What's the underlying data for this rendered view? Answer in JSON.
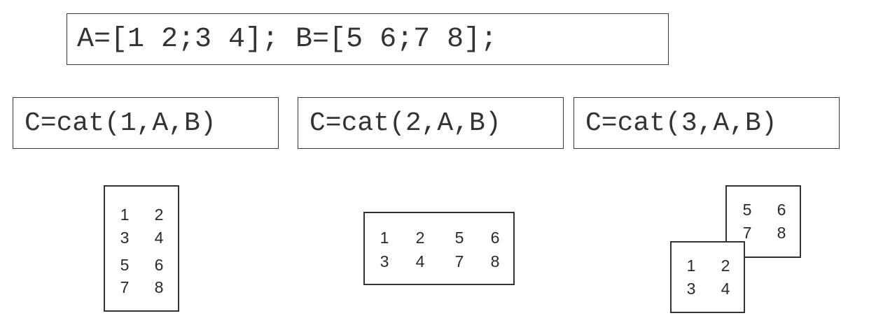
{
  "definitions": "A=[1 2;3 4]; B=[5 6;7 8];",
  "commands": [
    "C=cat(1,A,B)",
    "C=cat(2,A,B)",
    "C=cat(3,A,B)"
  ],
  "results": {
    "dim1": [
      [
        1,
        2
      ],
      [
        3,
        4
      ],
      [
        5,
        6
      ],
      [
        7,
        8
      ]
    ],
    "dim2": [
      [
        1,
        2,
        5,
        6
      ],
      [
        3,
        4,
        7,
        8
      ]
    ],
    "dim3": {
      "page_back": [
        [
          5,
          6
        ],
        [
          7,
          8
        ]
      ],
      "page_front": [
        [
          1,
          2
        ],
        [
          3,
          4
        ]
      ]
    }
  }
}
